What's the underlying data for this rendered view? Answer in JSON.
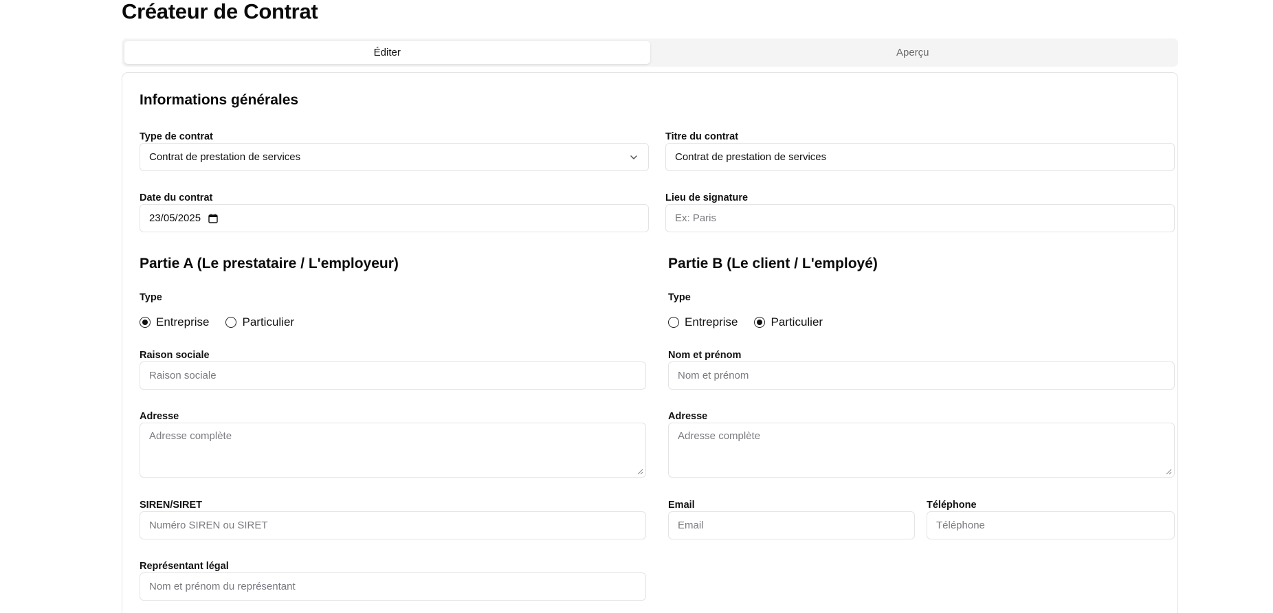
{
  "page": {
    "title": "Créateur de Contrat"
  },
  "tabs": [
    {
      "label": "Éditer",
      "active": true
    },
    {
      "label": "Aperçu",
      "active": false
    }
  ],
  "general": {
    "title": "Informations générales",
    "type_label": "Type de contrat",
    "type_value": "Contrat de prestation de services",
    "title_label": "Titre du contrat",
    "title_value": "Contrat de prestation de services",
    "date_label": "Date du contrat",
    "date_value": "23/05/2025",
    "place_label": "Lieu de signature",
    "place_placeholder": "Ex: Paris"
  },
  "party_a": {
    "title": "Partie A (Le prestataire / L'employeur)",
    "type_label": "Type",
    "options": [
      "Entreprise",
      "Particulier"
    ],
    "selected": "Entreprise",
    "name_label": "Raison sociale",
    "name_placeholder": "Raison sociale",
    "address_label": "Adresse",
    "address_placeholder": "Adresse complète",
    "siren_label": "SIREN/SIRET",
    "siren_placeholder": "Numéro SIREN ou SIRET",
    "rep_label": "Représentant légal",
    "rep_placeholder": "Nom et prénom du représentant"
  },
  "party_b": {
    "title": "Partie B (Le client / L'employé)",
    "type_label": "Type",
    "options": [
      "Entreprise",
      "Particulier"
    ],
    "selected": "Particulier",
    "name_label": "Nom et prénom",
    "name_placeholder": "Nom et prénom",
    "address_label": "Adresse",
    "address_placeholder": "Adresse complète",
    "email_label": "Email",
    "email_placeholder": "Email",
    "phone_label": "Téléphone",
    "phone_placeholder": "Téléphone"
  },
  "icons": {
    "select": "chevron-down-icon",
    "date": "calendar-icon",
    "textarea": "resize-handle-icon"
  }
}
